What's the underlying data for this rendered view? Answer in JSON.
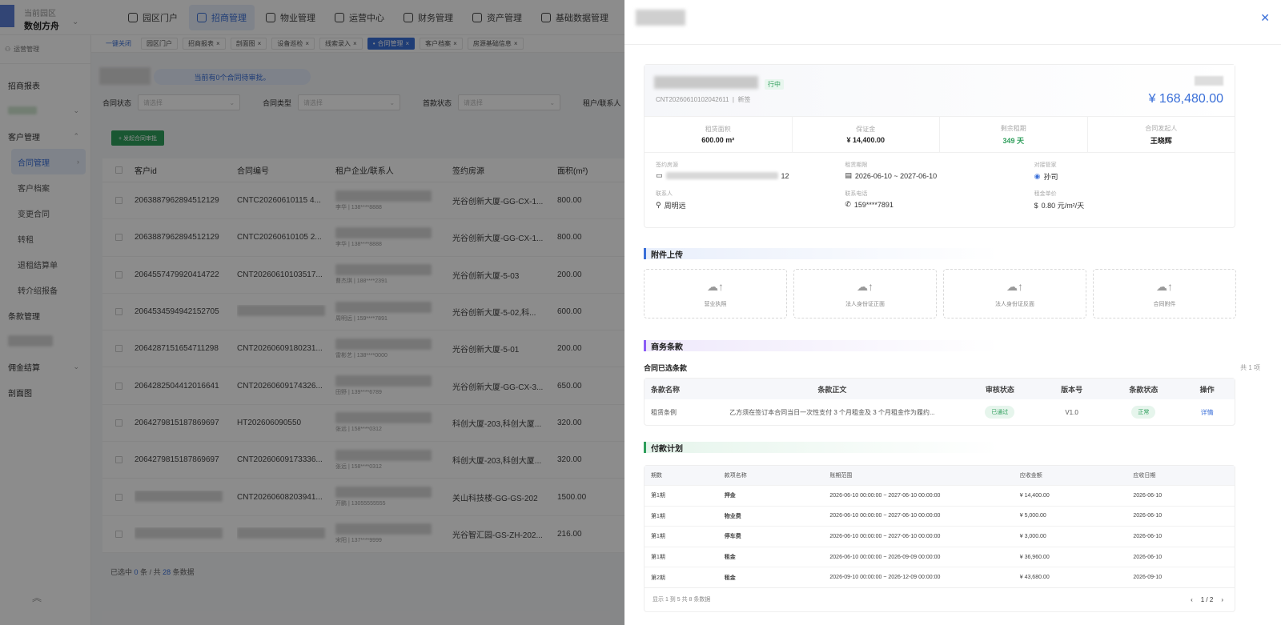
{
  "header": {
    "park_label": "当前园区",
    "park_name": "数创方舟",
    "nav": [
      {
        "label": "园区门户"
      },
      {
        "label": "招商管理"
      },
      {
        "label": "物业管理"
      },
      {
        "label": "运营中心"
      },
      {
        "label": "财务管理"
      },
      {
        "label": "资产管理"
      },
      {
        "label": "基础数据管理"
      }
    ]
  },
  "sidebar": {
    "header": "运营管理",
    "items": [
      {
        "label": "招商报表"
      },
      {
        "label": "客户管理"
      },
      {
        "label": "合同管理"
      },
      {
        "label": "客户档案"
      },
      {
        "label": "变更合同"
      },
      {
        "label": "转租"
      },
      {
        "label": "退租结算单"
      },
      {
        "label": "转介绍报备"
      },
      {
        "label": "条款管理"
      },
      {
        "label": "佣金结算"
      },
      {
        "label": "剖面图"
      }
    ]
  },
  "tabs": [
    {
      "label": "一键关闭"
    },
    {
      "label": "园区门户"
    },
    {
      "label": "招商报表"
    },
    {
      "label": "剖面图"
    },
    {
      "label": "设备巡检"
    },
    {
      "label": "线索录入"
    },
    {
      "label": "合同管理"
    },
    {
      "label": "客户档案"
    },
    {
      "label": "房源基础信息"
    }
  ],
  "main": {
    "notice": "当前有0个合同待审批。",
    "filters": {
      "status_label": "合同状态",
      "type_label": "合同类型",
      "first_label": "首款状态",
      "tenant_label": "租户/联系人",
      "placeholder": "请选择"
    },
    "create_btn": "+ 发起合同审批",
    "columns": [
      "客户id",
      "合同编号",
      "租户企业/联系人",
      "签约房源",
      "面积(m²)"
    ],
    "rows": [
      {
        "id": "2063887962894512129",
        "code": "CNTC20260610115 4...",
        "contact": "李华 | 138****8888",
        "room": "光谷创新大厦-GG-CX-1...",
        "area": "800.00"
      },
      {
        "id": "2063887962894512129",
        "code": "CNTC20260610105 2...",
        "contact": "李华 | 138****8888",
        "room": "光谷创新大厦-GG-CX-1...",
        "area": "800.00"
      },
      {
        "id": "2064557479920414722",
        "code": "CNT20260610103517...",
        "contact": "曹杰琪 | 188****2391",
        "room": "光谷创新大厦-5-03",
        "area": "200.00"
      },
      {
        "id": "2064534594942152705",
        "code": "",
        "contact": "周明远 | 159****7891",
        "room": "光谷创新大厦-5-02,科...",
        "area": "600.00"
      },
      {
        "id": "2064287151654711298",
        "code": "CNT20260609180231...",
        "contact": "雷彬艺 | 138****0000",
        "room": "光谷创新大厦-5-01",
        "area": "200.00"
      },
      {
        "id": "2064282504412016641",
        "code": "CNT20260609174326...",
        "contact": "田野 | 139****6789",
        "room": "光谷创新大厦-GG-CX-3...",
        "area": "650.00"
      },
      {
        "id": "2064279815187869697",
        "code": "HT202606090550",
        "contact": "张远 | 158****0312",
        "room": "科创大厦-203,科创大厦...",
        "area": "320.00"
      },
      {
        "id": "2064279815187869697",
        "code": "CNT20260609173336...",
        "contact": "张远 | 158****0312",
        "room": "科创大厦-203,科创大厦...",
        "area": "320.00"
      },
      {
        "id": "",
        "code": "CNT20260608203941...",
        "contact": "开鹏 | 13055555555",
        "room": "关山科技楼-GG-GS-202",
        "area": "1500.00"
      },
      {
        "id": "",
        "code": "",
        "contact": "宋阳 | 137****9999",
        "room": "光谷智汇园-GS-ZH-202...",
        "area": "216.00"
      }
    ],
    "footer": {
      "prefix": "已选中",
      "selected": "0",
      "mid": "条 / 共",
      "total": "28",
      "suffix": "条数据"
    }
  },
  "drawer": {
    "status": "行中",
    "code": "CNT20260610102042611",
    "sign_type": "新签",
    "amount": "¥ 168,480.00",
    "stats": [
      {
        "label": "租赁面积",
        "value": "600.00 m²"
      },
      {
        "label": "保证金",
        "value": "¥ 14,400.00"
      },
      {
        "label": "剩余租期",
        "value": "349 天"
      },
      {
        "label": "合同发起人",
        "value": "王晓辉"
      }
    ],
    "info": [
      {
        "label": "签约房源",
        "value": "12"
      },
      {
        "label": "租赁期限",
        "value": "2026-06-10 ~ 2027-06-10"
      },
      {
        "label": "对接管家",
        "value": "孙司"
      },
      {
        "label": "联系人",
        "value": "周明远"
      },
      {
        "label": "联系电话",
        "value": "159****7891"
      },
      {
        "label": "租金单价",
        "value": "0.80 元/m²/天"
      }
    ],
    "upload_title": "附件上传",
    "uploads": [
      {
        "label": "营业执照"
      },
      {
        "label": "法人身份证正面"
      },
      {
        "label": "法人身份证反面"
      },
      {
        "label": "合同附件"
      }
    ],
    "terms_title": "商务条款",
    "terms_sub": "合同已选条款",
    "terms_count": "共 1 项",
    "terms_cols": [
      "条款名称",
      "条款正文",
      "审核状态",
      "版本号",
      "条款状态",
      "操作"
    ],
    "terms_row": {
      "name": "租赁条例",
      "body": "乙方须在签订本合同当日一次性支付 3 个月租金及 3 个月租金作为履约...",
      "audit": "已通过",
      "version": "V1.0",
      "state": "正常",
      "action": "详情"
    },
    "pay_title": "付款计划",
    "pay_cols": [
      "期数",
      "款项名称",
      "账期范围",
      "应收金额",
      "应收日期"
    ],
    "pay_rows": [
      {
        "period": "第1期",
        "item": "押金",
        "range": "2026-06-10 00:00:00 ~ 2027-06-10 00:00:00",
        "amount": "¥ 14,400.00",
        "date": "2026-06-10"
      },
      {
        "period": "第1期",
        "item": "物业费",
        "range": "2026-06-10 00:00:00 ~ 2027-06-10 00:00:00",
        "amount": "¥ 5,000.00",
        "date": "2026-06-10"
      },
      {
        "period": "第1期",
        "item": "停车费",
        "range": "2026-06-10 00:00:00 ~ 2027-06-10 00:00:00",
        "amount": "¥ 3,000.00",
        "date": "2026-06-10"
      },
      {
        "period": "第1期",
        "item": "租金",
        "range": "2026-06-10 00:00:00 ~ 2026-09-09 00:00:00",
        "amount": "¥ 36,960.00",
        "date": "2026-06-10"
      },
      {
        "period": "第2期",
        "item": "租金",
        "range": "2026-09-10 00:00:00 ~ 2026-12-09 00:00:00",
        "amount": "¥ 43,680.00",
        "date": "2026-09-10"
      }
    ],
    "pay_footer": "显示 1 到 5 共 8 条数据",
    "pager": "1 / 2"
  }
}
